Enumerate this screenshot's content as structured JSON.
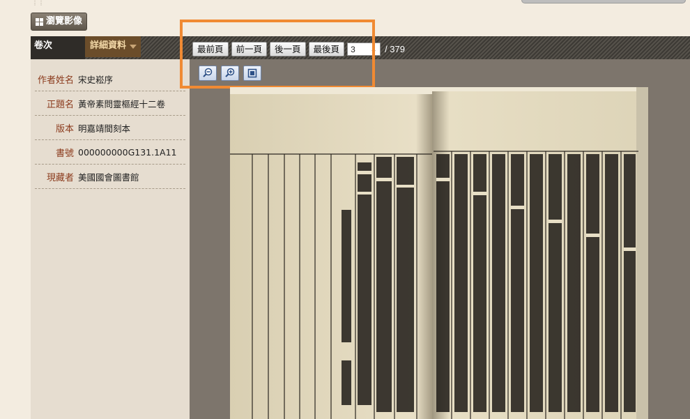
{
  "toolbar": {
    "browse_label": "瀏覽影像"
  },
  "tabs": {
    "volume": "卷次",
    "detail": "詳細資料"
  },
  "metadata": [
    {
      "key": "作者姓名",
      "value": "宋史崧序"
    },
    {
      "key": "正題名",
      "value": "黃帝素問靈樞經十二卷"
    },
    {
      "key": "版本",
      "value": "明嘉靖間刻本"
    },
    {
      "key": "書號",
      "value": "000000000G131.1A11"
    },
    {
      "key": "現藏者",
      "value": "美國國會圖書館"
    }
  ],
  "nav": {
    "first": "最前頁",
    "prev": "前一頁",
    "next": "後一頁",
    "last": "最後頁",
    "current_page": "3",
    "total": "/ 379"
  },
  "zoom": {
    "out_icon": "zoom-out-icon",
    "in_icon": "zoom-in-icon",
    "fit_icon": "fit-page-icon"
  },
  "colors": {
    "highlight": "#f08a33",
    "detail_tab": "#6b4d2a",
    "label": "#8b3a1c"
  }
}
